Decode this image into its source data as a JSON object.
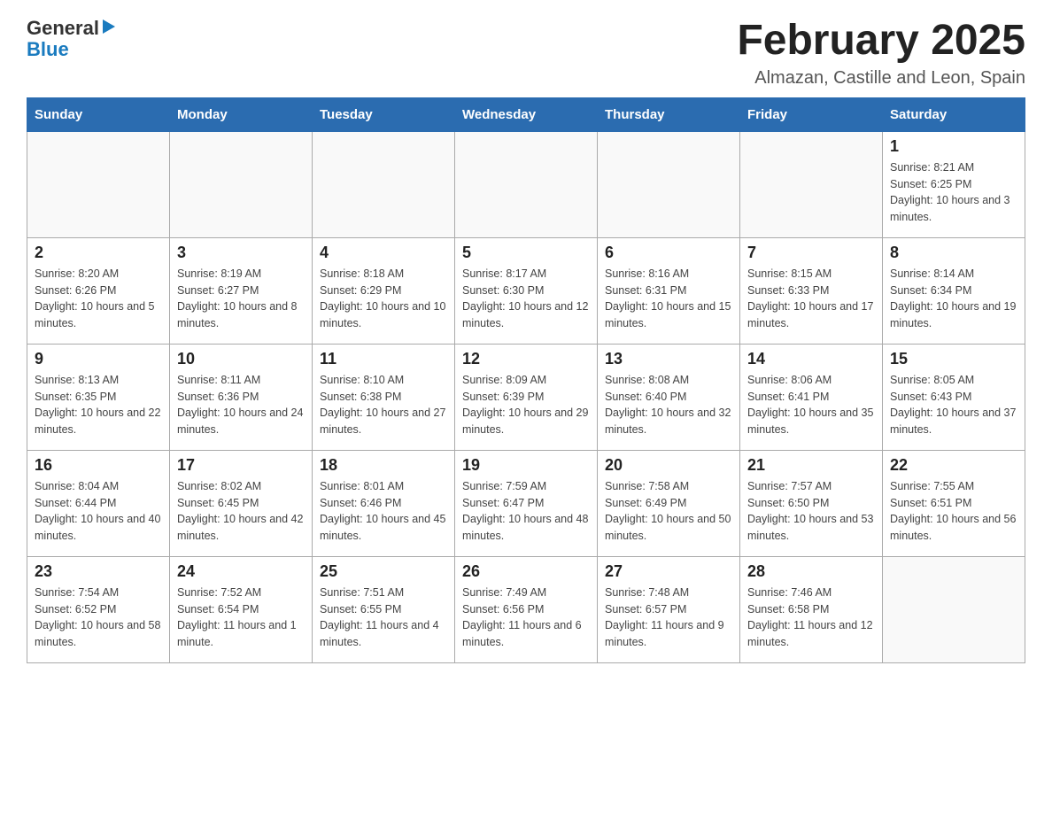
{
  "logo": {
    "general": "General",
    "blue": "Blue",
    "arrow": "▶"
  },
  "title": "February 2025",
  "subtitle": "Almazan, Castille and Leon, Spain",
  "weekdays": [
    "Sunday",
    "Monday",
    "Tuesday",
    "Wednesday",
    "Thursday",
    "Friday",
    "Saturday"
  ],
  "weeks": [
    [
      {
        "day": "",
        "info": ""
      },
      {
        "day": "",
        "info": ""
      },
      {
        "day": "",
        "info": ""
      },
      {
        "day": "",
        "info": ""
      },
      {
        "day": "",
        "info": ""
      },
      {
        "day": "",
        "info": ""
      },
      {
        "day": "1",
        "info": "Sunrise: 8:21 AM\nSunset: 6:25 PM\nDaylight: 10 hours and 3 minutes."
      }
    ],
    [
      {
        "day": "2",
        "info": "Sunrise: 8:20 AM\nSunset: 6:26 PM\nDaylight: 10 hours and 5 minutes."
      },
      {
        "day": "3",
        "info": "Sunrise: 8:19 AM\nSunset: 6:27 PM\nDaylight: 10 hours and 8 minutes."
      },
      {
        "day": "4",
        "info": "Sunrise: 8:18 AM\nSunset: 6:29 PM\nDaylight: 10 hours and 10 minutes."
      },
      {
        "day": "5",
        "info": "Sunrise: 8:17 AM\nSunset: 6:30 PM\nDaylight: 10 hours and 12 minutes."
      },
      {
        "day": "6",
        "info": "Sunrise: 8:16 AM\nSunset: 6:31 PM\nDaylight: 10 hours and 15 minutes."
      },
      {
        "day": "7",
        "info": "Sunrise: 8:15 AM\nSunset: 6:33 PM\nDaylight: 10 hours and 17 minutes."
      },
      {
        "day": "8",
        "info": "Sunrise: 8:14 AM\nSunset: 6:34 PM\nDaylight: 10 hours and 19 minutes."
      }
    ],
    [
      {
        "day": "9",
        "info": "Sunrise: 8:13 AM\nSunset: 6:35 PM\nDaylight: 10 hours and 22 minutes."
      },
      {
        "day": "10",
        "info": "Sunrise: 8:11 AM\nSunset: 6:36 PM\nDaylight: 10 hours and 24 minutes."
      },
      {
        "day": "11",
        "info": "Sunrise: 8:10 AM\nSunset: 6:38 PM\nDaylight: 10 hours and 27 minutes."
      },
      {
        "day": "12",
        "info": "Sunrise: 8:09 AM\nSunset: 6:39 PM\nDaylight: 10 hours and 29 minutes."
      },
      {
        "day": "13",
        "info": "Sunrise: 8:08 AM\nSunset: 6:40 PM\nDaylight: 10 hours and 32 minutes."
      },
      {
        "day": "14",
        "info": "Sunrise: 8:06 AM\nSunset: 6:41 PM\nDaylight: 10 hours and 35 minutes."
      },
      {
        "day": "15",
        "info": "Sunrise: 8:05 AM\nSunset: 6:43 PM\nDaylight: 10 hours and 37 minutes."
      }
    ],
    [
      {
        "day": "16",
        "info": "Sunrise: 8:04 AM\nSunset: 6:44 PM\nDaylight: 10 hours and 40 minutes."
      },
      {
        "day": "17",
        "info": "Sunrise: 8:02 AM\nSunset: 6:45 PM\nDaylight: 10 hours and 42 minutes."
      },
      {
        "day": "18",
        "info": "Sunrise: 8:01 AM\nSunset: 6:46 PM\nDaylight: 10 hours and 45 minutes."
      },
      {
        "day": "19",
        "info": "Sunrise: 7:59 AM\nSunset: 6:47 PM\nDaylight: 10 hours and 48 minutes."
      },
      {
        "day": "20",
        "info": "Sunrise: 7:58 AM\nSunset: 6:49 PM\nDaylight: 10 hours and 50 minutes."
      },
      {
        "day": "21",
        "info": "Sunrise: 7:57 AM\nSunset: 6:50 PM\nDaylight: 10 hours and 53 minutes."
      },
      {
        "day": "22",
        "info": "Sunrise: 7:55 AM\nSunset: 6:51 PM\nDaylight: 10 hours and 56 minutes."
      }
    ],
    [
      {
        "day": "23",
        "info": "Sunrise: 7:54 AM\nSunset: 6:52 PM\nDaylight: 10 hours and 58 minutes."
      },
      {
        "day": "24",
        "info": "Sunrise: 7:52 AM\nSunset: 6:54 PM\nDaylight: 11 hours and 1 minute."
      },
      {
        "day": "25",
        "info": "Sunrise: 7:51 AM\nSunset: 6:55 PM\nDaylight: 11 hours and 4 minutes."
      },
      {
        "day": "26",
        "info": "Sunrise: 7:49 AM\nSunset: 6:56 PM\nDaylight: 11 hours and 6 minutes."
      },
      {
        "day": "27",
        "info": "Sunrise: 7:48 AM\nSunset: 6:57 PM\nDaylight: 11 hours and 9 minutes."
      },
      {
        "day": "28",
        "info": "Sunrise: 7:46 AM\nSunset: 6:58 PM\nDaylight: 11 hours and 12 minutes."
      },
      {
        "day": "",
        "info": ""
      }
    ]
  ]
}
